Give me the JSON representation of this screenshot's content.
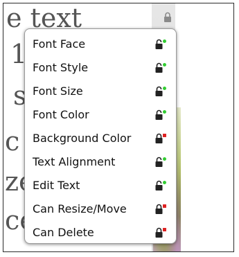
{
  "canvas": {
    "lines": [
      "e text",
      "1",
      "s",
      "c",
      "ze",
      "ce"
    ]
  },
  "menu": {
    "items": [
      {
        "label": "Font Face",
        "state": "unlocked",
        "status_color": "#33cc33"
      },
      {
        "label": "Font Style",
        "state": "unlocked",
        "status_color": "#33cc33"
      },
      {
        "label": "Font Size",
        "state": "unlocked",
        "status_color": "#33cc33"
      },
      {
        "label": "Font Color",
        "state": "unlocked",
        "status_color": "#33cc33"
      },
      {
        "label": "Background Color",
        "state": "locked",
        "status_color": "#dd2222"
      },
      {
        "label": "Text Alignment",
        "state": "unlocked",
        "status_color": "#33cc33"
      },
      {
        "label": "Edit Text",
        "state": "unlocked",
        "status_color": "#33cc33"
      },
      {
        "label": "Can Resize/Move",
        "state": "locked",
        "status_color": "#dd2222"
      },
      {
        "label": "Can Delete",
        "state": "locked",
        "status_color": "#dd2222"
      }
    ]
  },
  "icons": {
    "panel_lock": "lock-icon",
    "item_lock": "padlock-icon"
  }
}
